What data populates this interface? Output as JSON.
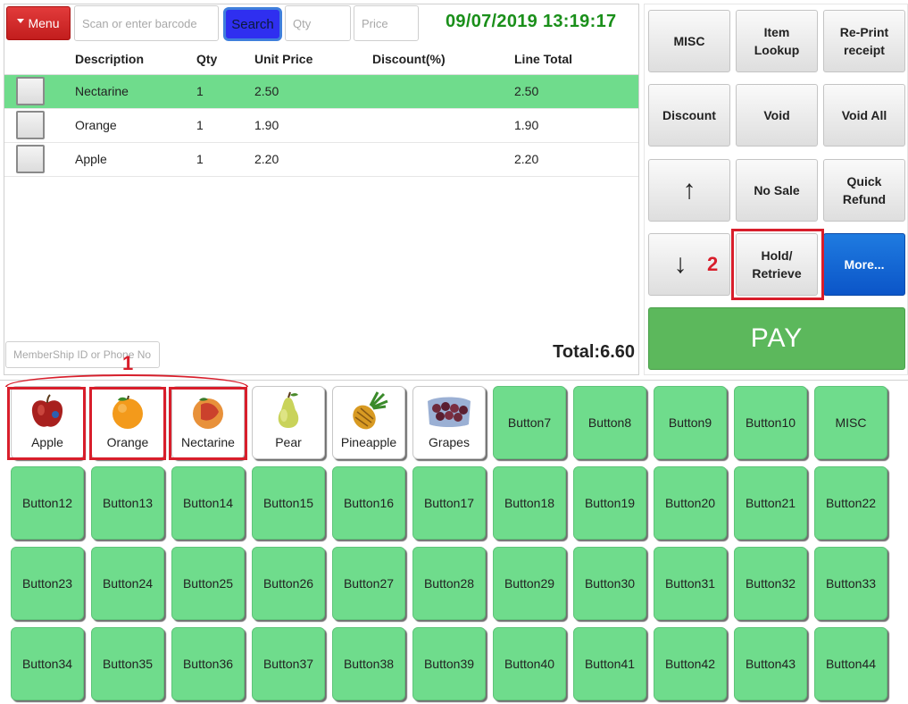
{
  "topbar": {
    "menu_label": "Menu",
    "barcode_placeholder": "Scan or enter barcode",
    "search_label": "Search",
    "qty_placeholder": "Qty",
    "price_placeholder": "Price",
    "datetime": "09/07/2019 13:19:17"
  },
  "table": {
    "headers": [
      "Description",
      "Qty",
      "Unit Price",
      "Discount(%)",
      "Line Total"
    ],
    "rows": [
      {
        "description": "Nectarine",
        "qty": "1",
        "unit_price": "2.50",
        "discount": "",
        "line_total": "2.50",
        "selected": true
      },
      {
        "description": "Orange",
        "qty": "1",
        "unit_price": "1.90",
        "discount": "",
        "line_total": "1.90",
        "selected": false
      },
      {
        "description": "Apple",
        "qty": "1",
        "unit_price": "2.20",
        "discount": "",
        "line_total": "2.20",
        "selected": false
      }
    ]
  },
  "member_placeholder": "MemberShip ID or Phone No.",
  "total_text": "Total:6.60",
  "functions": {
    "misc": "MISC",
    "item_lookup": "Item\nLookup",
    "reprint": "Re-Print\nreceipt",
    "discount": "Discount",
    "void": "Void",
    "void_all": "Void All",
    "up_arrow": "↑",
    "no_sale": "No Sale",
    "quick_refund": "Quick\nRefund",
    "down_arrow": "↓",
    "hold_retrieve": "Hold/\nRetrieve",
    "more": "More...",
    "pay": "PAY"
  },
  "annotations": {
    "label_1": "1",
    "label_2": "2"
  },
  "products": [
    "Apple",
    "Orange",
    "Nectarine",
    "Pear",
    "Pineapple",
    "Grapes"
  ],
  "grid_row1": [
    "Button7",
    "Button8",
    "Button9",
    "Button10",
    "MISC"
  ],
  "grid_rows": [
    [
      "Button12",
      "Button13",
      "Button14",
      "Button15",
      "Button16",
      "Button17",
      "Button18",
      "Button19",
      "Button20",
      "Button21",
      "Button22"
    ],
    [
      "Button23",
      "Button24",
      "Button25",
      "Button26",
      "Button27",
      "Button28",
      "Button29",
      "Button30",
      "Button31",
      "Button32",
      "Button33"
    ],
    [
      "Button34",
      "Button35",
      "Button36",
      "Button37",
      "Button38",
      "Button39",
      "Button40",
      "Button41",
      "Button42",
      "Button43",
      "Button44"
    ]
  ],
  "colors": {
    "accent_green": "#6fdc8c",
    "pay_green": "#5cb85c",
    "datetime_green": "#1a8f1a",
    "annotation_red": "#d81e2b",
    "menu_red": "#d12a2a",
    "more_blue": "#0b55c8"
  }
}
